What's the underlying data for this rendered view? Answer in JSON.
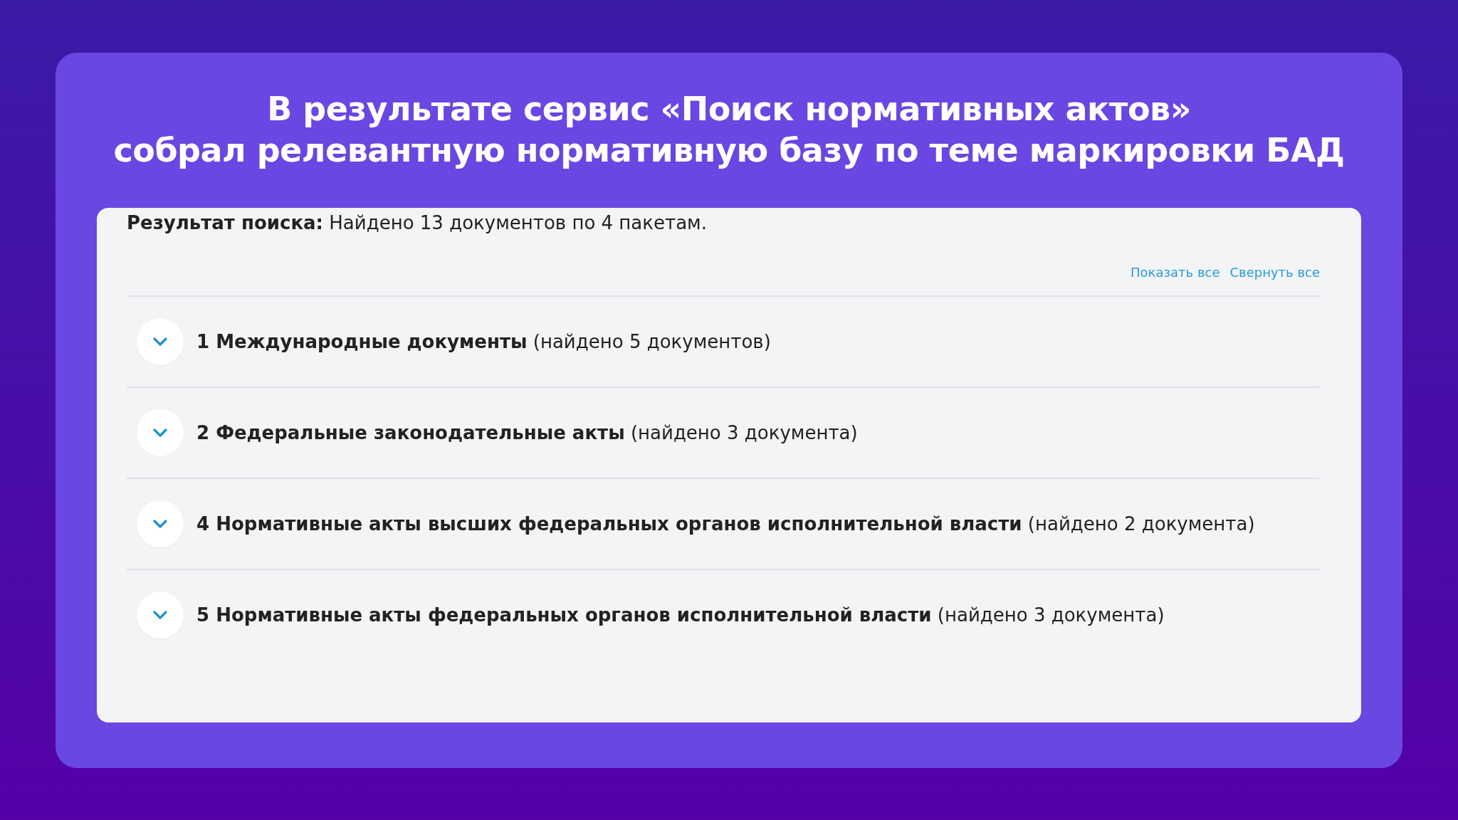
{
  "slide_title": [
    "В результате сервис «Поиск нормативных актов»",
    "собрал релевантную нормативную базу по теме маркировки БАД"
  ],
  "search_result": "**Результат поиска:** Найдено 13 документов по 4 пакетам.",
  "links": [
    "Показать все",
    "Свернуть все"
  ],
  "groups": [
    {
      "label": "**1 Международные документы** (найдено 5 документов)"
    },
    {
      "label": "**2 Федеральные законодательные акты** (найдено 3 документа)"
    },
    {
      "label": "**4 Нормативные акты высших федеральных органов исполнительной власти** (найдено 2 документа)"
    },
    {
      "label": "**5 Нормативные акты федеральных органов исполнительной власти** (найдено 3 документа)"
    }
  ]
}
